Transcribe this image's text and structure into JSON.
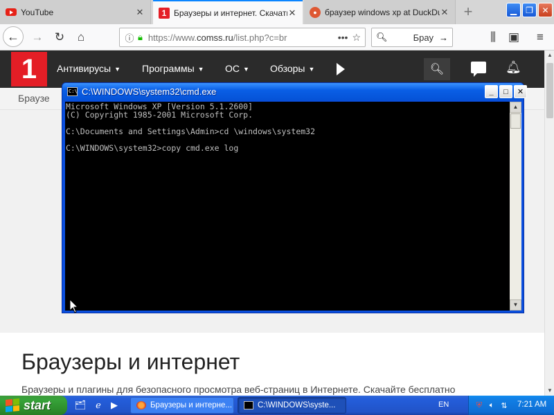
{
  "browser": {
    "tabs": [
      {
        "label": "YouTube",
        "close": "✕"
      },
      {
        "label": "Браузеры и интернет. Скачать",
        "close": "✕"
      },
      {
        "label": "браузер windows xp at DuckDuck",
        "close": "✕"
      }
    ],
    "new_tab": "+",
    "url": {
      "scheme": "https://www.",
      "host": "comss.ru",
      "path": "/list.php?c=br"
    },
    "search": {
      "value": "Брау"
    }
  },
  "site": {
    "nav": [
      {
        "label": "Антивирусы"
      },
      {
        "label": "Программы"
      },
      {
        "label": "ОС"
      },
      {
        "label": "Обзоры"
      }
    ],
    "logo": "1",
    "breadcrumb": "Браузе",
    "title": "Браузеры и интернет",
    "description": "Браузеры и плагины для безопасного просмотра веб-страниц в Интернете. Скачайте бесплатно"
  },
  "cmd": {
    "title": "C:\\WINDOWS\\system32\\cmd.exe",
    "icon_text": "C:\\",
    "lines": "Microsoft Windows XP [Version 5.1.2600]\n(C) Copyright 1985-2001 Microsoft Corp.\n\nC:\\Documents and Settings\\Admin>cd \\windows\\system32\n\nC:\\WINDOWS\\system32>copy cmd.exe log"
  },
  "taskbar": {
    "start_label": "start",
    "tasks": [
      {
        "label": "Браузеры и интерне..."
      },
      {
        "label": "C:\\WINDOWS\\syste..."
      }
    ],
    "language": "EN",
    "clock": "7:21 AM"
  },
  "colors": {
    "site_header": "#2b2b2b",
    "brand_red": "#e41e26",
    "xp_title_blue": "#0a5fe6",
    "xp_start_green": "#37a33a"
  },
  "icons": [
    "youtube-favicon",
    "comss-favicon",
    "duckduckgo-favicon",
    "back-icon",
    "forward-icon",
    "reload-icon",
    "home-icon",
    "info-icon",
    "lock-icon",
    "more-icon",
    "bookmark-star-icon",
    "search-icon",
    "arrow-right-icon",
    "library-icon",
    "sidebar-icon",
    "menu-icon",
    "chat-icon",
    "bell-icon",
    "cmd-icon",
    "windows-flag-icon",
    "explorer-icon",
    "ie-icon",
    "media-player-icon",
    "shield-icon",
    "speaker-icon",
    "network-icon"
  ]
}
